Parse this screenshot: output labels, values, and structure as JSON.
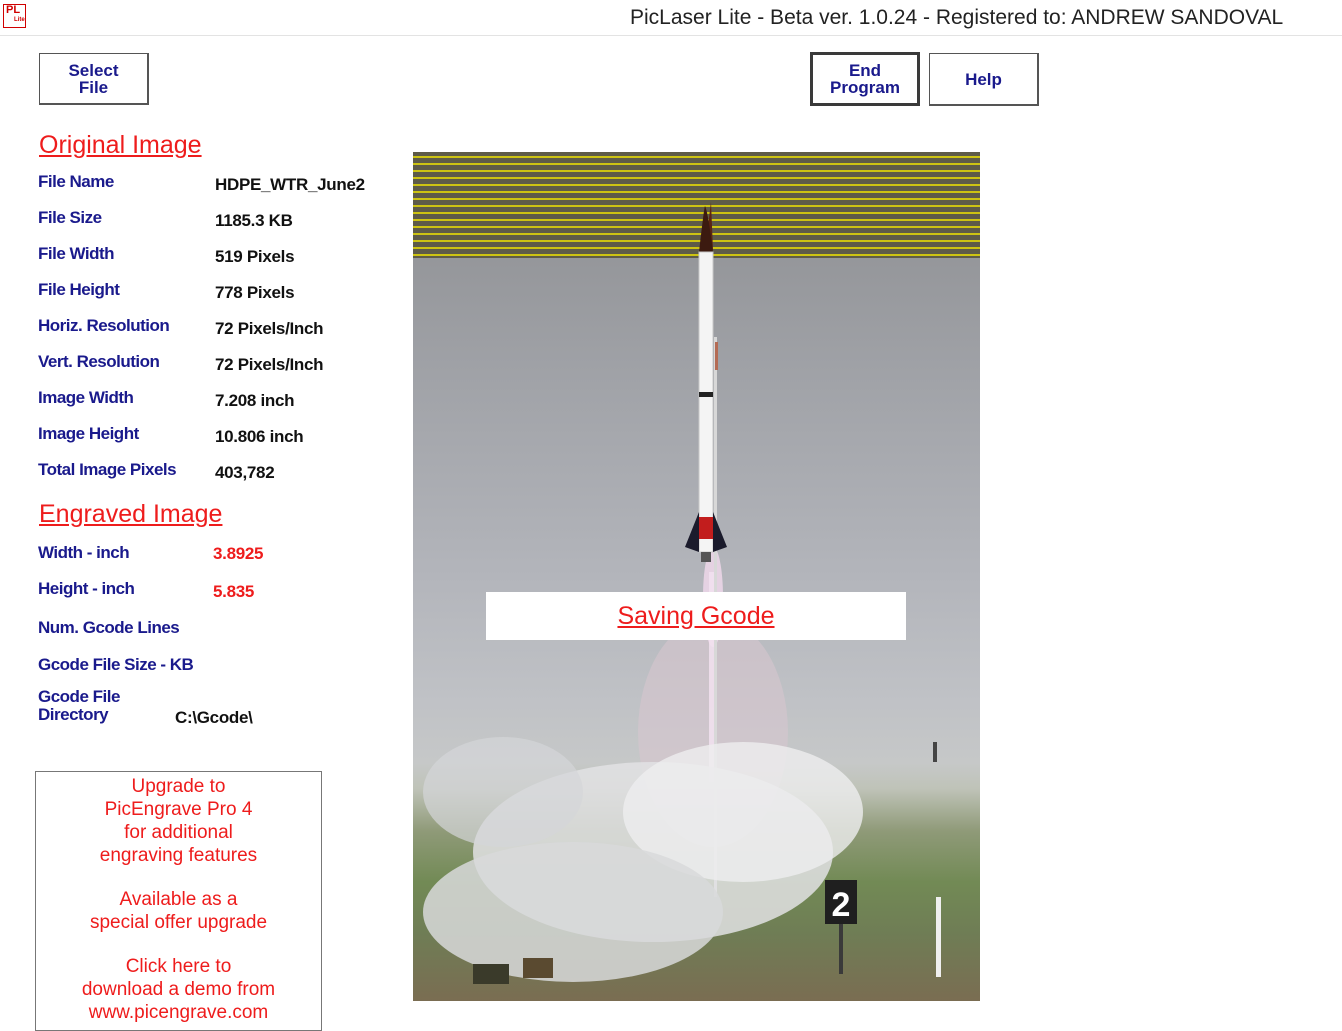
{
  "window": {
    "app_icon_text": "PL",
    "app_icon_sub": "Lite",
    "title": "PicLaser Lite - Beta ver. 1.0.24 - Registered to: ANDREW SANDOVAL"
  },
  "toolbar": {
    "select_file_label": "Select\nFile",
    "end_program_label": "End\nProgram",
    "help_label": "Help"
  },
  "original_image": {
    "heading": "Original Image",
    "rows": [
      {
        "label": "File Name",
        "value": "HDPE_WTR_June2"
      },
      {
        "label": "File Size",
        "value": "1185.3  KB"
      },
      {
        "label": "File Width",
        "value": "519  Pixels"
      },
      {
        "label": "File Height",
        "value": "778  Pixels"
      },
      {
        "label": "Horiz. Resolution",
        "value": "72  Pixels/Inch"
      },
      {
        "label": "Vert. Resolution",
        "value": "72  Pixels/Inch"
      },
      {
        "label": "Image Width",
        "value": "7.208 inch"
      },
      {
        "label": "Image Height",
        "value": "10.806 inch"
      },
      {
        "label": "Total Image Pixels",
        "value": "403,782"
      }
    ]
  },
  "engraved_image": {
    "heading": "Engraved Image",
    "width_label": "Width - inch",
    "width_value": "3.8925",
    "height_label": "Height - inch",
    "height_value": "5.835",
    "gcode_lines_label": "Num. Gcode Lines",
    "gcode_size_label": "Gcode File Size - KB",
    "gcode_dir_label_1": "Gcode File",
    "gcode_dir_label_2": "Directory",
    "gcode_dir_value": "C:\\Gcode\\"
  },
  "upgrade": {
    "para1": "Upgrade  to\nPicEngrave Pro 4\nfor additional\nengraving  features",
    "para2": "Available as a\nspecial  offer upgrade",
    "para3": "Click here to\ndownload  a demo from\nwww.picengrave.com"
  },
  "preview": {
    "status": "Saving Gcode",
    "sign_text": "2",
    "scan_line_color": "#f2e600"
  },
  "colors": {
    "label_blue": "#1a1a8c",
    "accent_red": "#ee1c1c"
  }
}
